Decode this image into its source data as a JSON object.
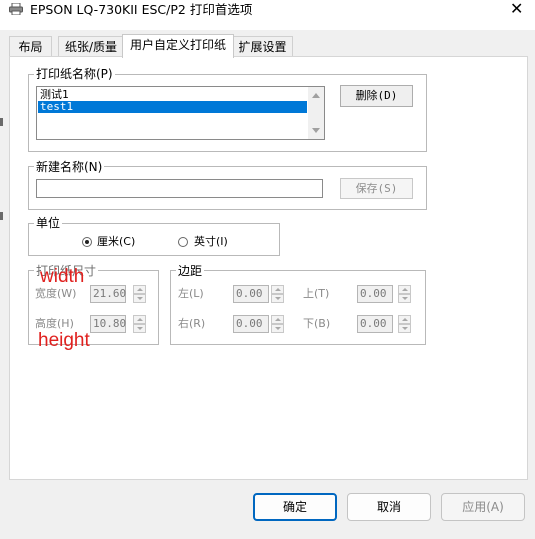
{
  "window": {
    "title": "EPSON LQ-730KII ESC/P2 打印首选项",
    "close_icon": "close-icon",
    "app_icon": "printer-icon"
  },
  "tabs": [
    {
      "label": "布局",
      "active": false
    },
    {
      "label": "纸张/质量",
      "active": false
    },
    {
      "label": "用户自定义打印纸",
      "active": true
    },
    {
      "label": "扩展设置",
      "active": false
    }
  ],
  "paper_name_group": {
    "legend": "打印纸名称(P)",
    "items": [
      {
        "label": "测试1",
        "selected": false
      },
      {
        "label": "test1",
        "selected": true
      }
    ],
    "delete_button": "删除(D)"
  },
  "new_name_group": {
    "legend": "新建名称(N)",
    "value": "",
    "save_button": "保存(S)"
  },
  "unit_group": {
    "legend": "单位",
    "options": [
      {
        "label": "厘米(C)",
        "checked": true
      },
      {
        "label": "英寸(I)",
        "checked": false
      }
    ]
  },
  "paper_size_group": {
    "legend": "打印纸尺寸",
    "width_label": "宽度(W)",
    "width_value": "21.60",
    "height_label": "高度(H)",
    "height_value": "10.80"
  },
  "margin_group": {
    "legend": "边距",
    "left_label": "左(L)",
    "left_value": "0.00",
    "top_label": "上(T)",
    "top_value": "0.00",
    "right_label": "右(R)",
    "right_value": "0.00",
    "bottom_label": "下(B)",
    "bottom_value": "0.00"
  },
  "annotations": {
    "width": "width",
    "height": "height",
    "color": "#e0211f"
  },
  "footer": {
    "ok": "确定",
    "cancel": "取消",
    "apply": "应用(A)"
  }
}
